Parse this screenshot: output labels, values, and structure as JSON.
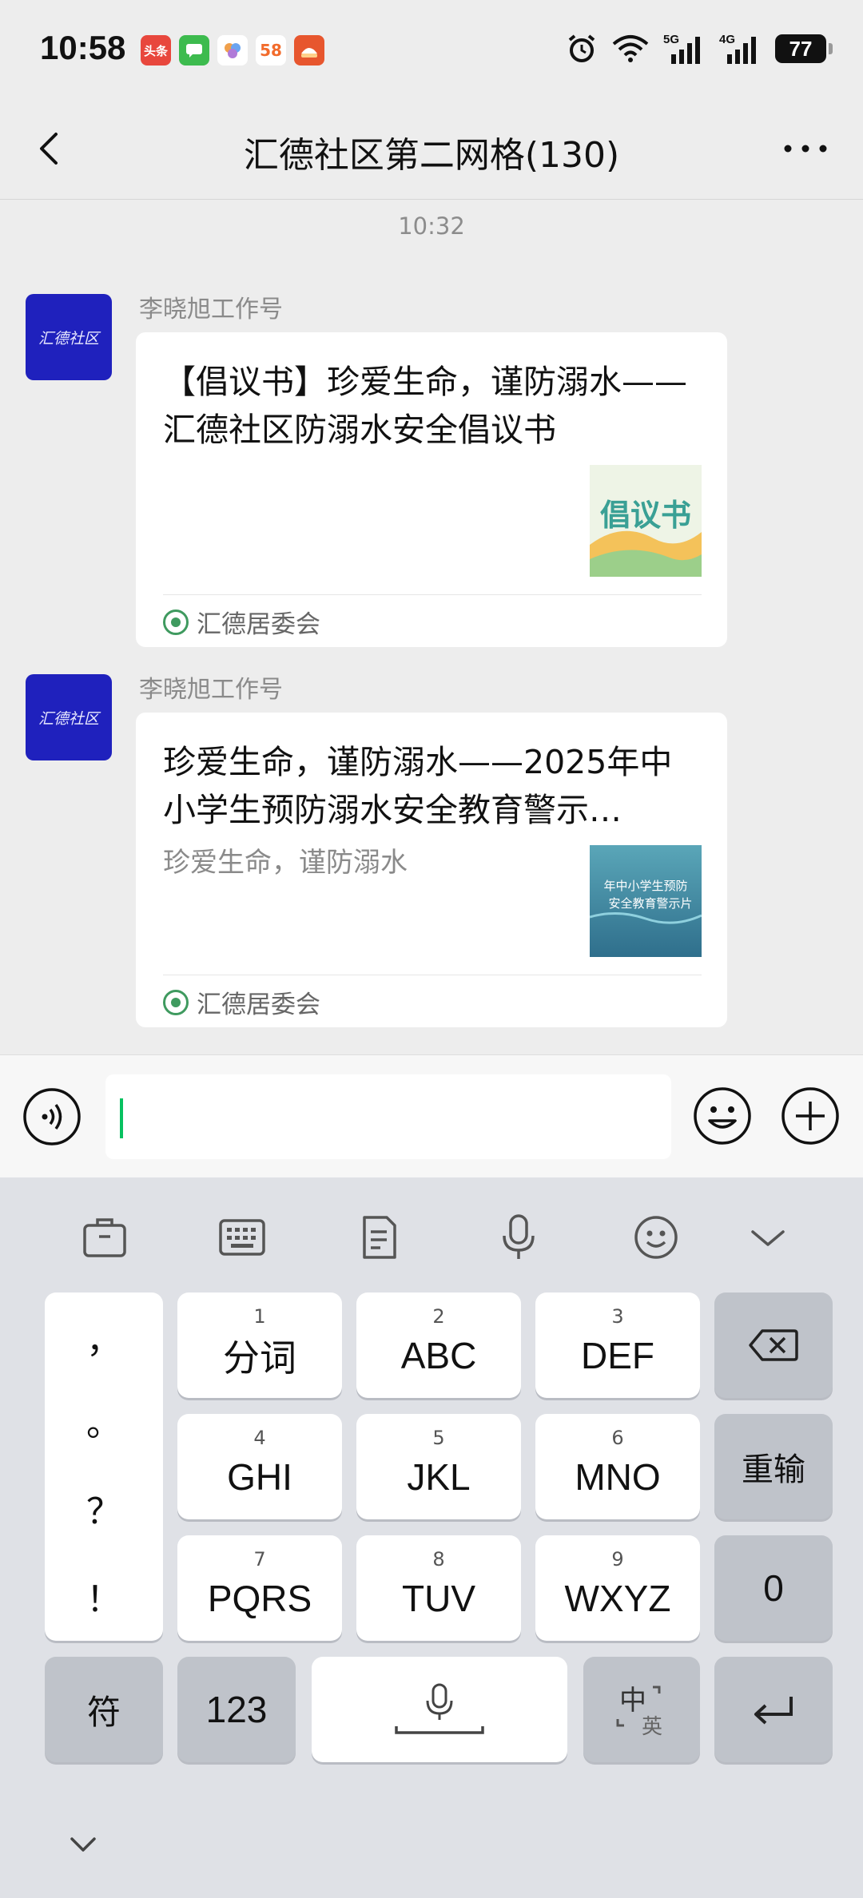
{
  "status_bar": {
    "time": "10:58",
    "apps": [
      {
        "name": "toutiao-app-icon",
        "label": "头条",
        "color": "#e8473d"
      },
      {
        "name": "messages-app-icon",
        "label": "",
        "color": "#3dbb4e"
      },
      {
        "name": "cloud-app-icon",
        "label": "",
        "color": "#6aa4f0"
      },
      {
        "name": "58-app-icon",
        "label": "58",
        "color": "#f26b2b"
      },
      {
        "name": "game-app-icon",
        "label": "",
        "color": "#e7562e"
      }
    ],
    "network": [
      "5G",
      "4G"
    ],
    "battery": "77"
  },
  "nav": {
    "title": "汇德社区第二网格(130)"
  },
  "chat": {
    "timestamp": "10:32",
    "messages": [
      {
        "avatar_text": "汇德社区",
        "sender": "李晓旭工作号",
        "title": "【倡议书】珍爱生命，谨防溺水——汇德社区防溺水安全倡议书",
        "description": "",
        "thumb_text": "倡议书",
        "source": "汇德居委会"
      },
      {
        "avatar_text": "汇德社区",
        "sender": "李晓旭工作号",
        "title": "珍爱生命，谨防溺水——2025年中小学生预防溺水安全教育警示…",
        "description": "珍爱生命，谨防溺水",
        "thumb_text": "年中小学生预防安全教育警示片",
        "source": "汇德居委会"
      }
    ]
  },
  "input": {
    "value": ""
  },
  "keyboard": {
    "punctuation": [
      "，",
      "。",
      "？",
      "！"
    ],
    "keys": [
      {
        "num": "1",
        "label": "分词"
      },
      {
        "num": "2",
        "label": "ABC"
      },
      {
        "num": "3",
        "label": "DEF"
      },
      {
        "num": "4",
        "label": "GHI"
      },
      {
        "num": "5",
        "label": "JKL"
      },
      {
        "num": "6",
        "label": "MNO"
      },
      {
        "num": "7",
        "label": "PQRS"
      },
      {
        "num": "8",
        "label": "TUV"
      },
      {
        "num": "9",
        "label": "WXYZ"
      }
    ],
    "reinput": "重输",
    "zero": "0",
    "symbols": "符",
    "numbers": "123",
    "lang_main": "中",
    "lang_sub": "英"
  },
  "colors": {
    "accent": "#07c160",
    "avatar_bg": "#1f21bd",
    "chat_bg": "#ededed"
  }
}
